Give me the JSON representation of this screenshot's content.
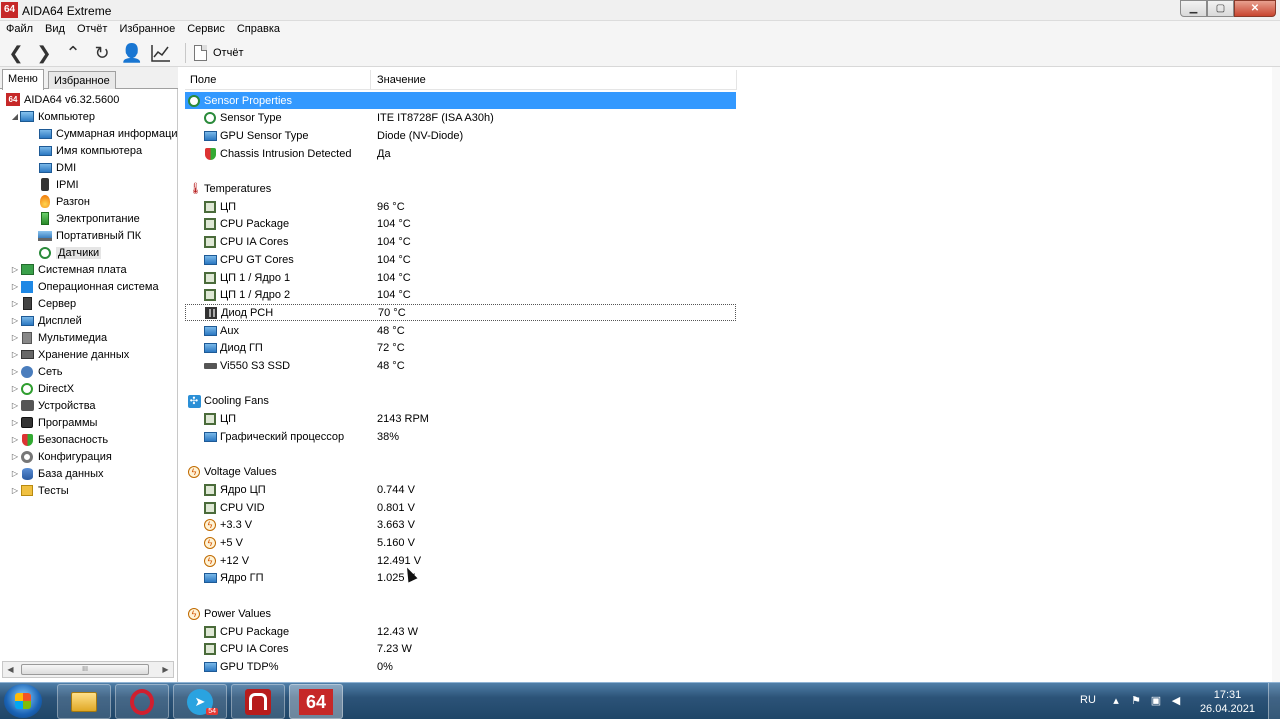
{
  "window": {
    "app_icon_text": "64",
    "title": "AIDA64 Extreme",
    "min_icon": "minimize-icon",
    "max_icon": "maximize-icon",
    "close_icon": "close-icon"
  },
  "menubar": [
    "Файл",
    "Вид",
    "Отчёт",
    "Избранное",
    "Сервис",
    "Справка"
  ],
  "toolbar": {
    "report_label": "Отчёт",
    "buttons": [
      "back-icon",
      "forward-icon",
      "up-icon",
      "refresh-icon",
      "user-icon",
      "chart-icon"
    ]
  },
  "left_tabs": {
    "menu": "Меню",
    "favorites": "Избранное"
  },
  "tree": [
    {
      "label": "AIDA64 v6.32.5600",
      "icon": "aida64-icon",
      "level": 0,
      "expander": ""
    },
    {
      "label": "Компьютер",
      "icon": "computer-icon",
      "level": 1,
      "expander": "◢"
    },
    {
      "label": "Суммарная информация",
      "icon": "monitor-icon",
      "level": 2,
      "expander": ""
    },
    {
      "label": "Имя компьютера",
      "icon": "monitor-icon",
      "level": 2,
      "expander": ""
    },
    {
      "label": "DMI",
      "icon": "monitor-icon",
      "level": 2,
      "expander": ""
    },
    {
      "label": "IPMI",
      "icon": "phone-icon",
      "level": 2,
      "expander": ""
    },
    {
      "label": "Разгон",
      "icon": "flame-icon",
      "level": 2,
      "expander": ""
    },
    {
      "label": "Электропитание",
      "icon": "power-icon",
      "level": 2,
      "expander": ""
    },
    {
      "label": "Портативный ПК",
      "icon": "laptop-icon",
      "level": 2,
      "expander": ""
    },
    {
      "label": "Датчики",
      "icon": "gauge-icon",
      "level": 2,
      "expander": "",
      "selected": true
    },
    {
      "label": "Системная плата",
      "icon": "motherboard-icon",
      "level": 1,
      "expander": "▷"
    },
    {
      "label": "Операционная система",
      "icon": "windows-icon",
      "level": 1,
      "expander": "▷"
    },
    {
      "label": "Сервер",
      "icon": "server-icon",
      "level": 1,
      "expander": "▷"
    },
    {
      "label": "Дисплей",
      "icon": "monitor-icon",
      "level": 1,
      "expander": "▷"
    },
    {
      "label": "Мультимедиа",
      "icon": "speaker-icon",
      "level": 1,
      "expander": "▷"
    },
    {
      "label": "Хранение данных",
      "icon": "hdd-icon",
      "level": 1,
      "expander": "▷"
    },
    {
      "label": "Сеть",
      "icon": "network-icon",
      "level": 1,
      "expander": "▷"
    },
    {
      "label": "DirectX",
      "icon": "xbox-icon",
      "level": 1,
      "expander": "▷"
    },
    {
      "label": "Устройства",
      "icon": "usb-icon",
      "level": 1,
      "expander": "▷"
    },
    {
      "label": "Программы",
      "icon": "camera-icon",
      "level": 1,
      "expander": "▷"
    },
    {
      "label": "Безопасность",
      "icon": "shield-icon",
      "level": 1,
      "expander": "▷"
    },
    {
      "label": "Конфигурация",
      "icon": "cog-icon",
      "level": 1,
      "expander": "▷"
    },
    {
      "label": "База данных",
      "icon": "database-icon",
      "level": 1,
      "expander": "▷"
    },
    {
      "label": "Тесты",
      "icon": "test-icon",
      "level": 1,
      "expander": "▷"
    }
  ],
  "columns": {
    "field": "Поле",
    "value": "Значение"
  },
  "rows": [
    {
      "type": "section",
      "field": "Sensor Properties",
      "value": "",
      "icon": "sensor-icon",
      "highlight": true
    },
    {
      "type": "item",
      "field": "Sensor Type",
      "value": "ITE IT8728F  (ISA A30h)",
      "icon": "gauge-icon"
    },
    {
      "type": "item",
      "field": "GPU Sensor Type",
      "value": "Diode  (NV-Diode)",
      "icon": "monitor-icon"
    },
    {
      "type": "item",
      "field": "Chassis Intrusion Detected",
      "value": "Да",
      "icon": "shield-icon"
    },
    {
      "type": "spacer"
    },
    {
      "type": "section",
      "field": "Temperatures",
      "value": "",
      "icon": "thermometer-icon"
    },
    {
      "type": "item",
      "field": "ЦП",
      "value": "96 °C",
      "icon": "cpu-chip-icon"
    },
    {
      "type": "item",
      "field": "CPU Package",
      "value": "104 °C",
      "icon": "cpu-chip-icon"
    },
    {
      "type": "item",
      "field": "CPU IA Cores",
      "value": "104 °C",
      "icon": "cpu-chip-icon"
    },
    {
      "type": "item",
      "field": "CPU GT Cores",
      "value": "104 °C",
      "icon": "monitor-icon"
    },
    {
      "type": "item",
      "field": "ЦП 1 / Ядро 1",
      "value": "104 °C",
      "icon": "cpu-chip-icon"
    },
    {
      "type": "item",
      "field": "ЦП 1 / Ядро 2",
      "value": "104 °C",
      "icon": "cpu-chip-icon"
    },
    {
      "type": "item",
      "field": "Диод PCH",
      "value": "70 °C",
      "icon": "pch-chip-icon",
      "focused": true
    },
    {
      "type": "item",
      "field": "Aux",
      "value": "48 °C",
      "icon": "monitor-icon"
    },
    {
      "type": "item",
      "field": "Диод ГП",
      "value": "72 °C",
      "icon": "monitor-icon"
    },
    {
      "type": "item",
      "field": "Vi550 S3 SSD",
      "value": "48 °C",
      "icon": "ssd-icon"
    },
    {
      "type": "spacer"
    },
    {
      "type": "section",
      "field": "Cooling Fans",
      "value": "",
      "icon": "fan-icon"
    },
    {
      "type": "item",
      "field": "ЦП",
      "value": "2143 RPM",
      "icon": "cpu-chip-icon"
    },
    {
      "type": "item",
      "field": "Графический процессор",
      "value": "38%",
      "icon": "monitor-icon"
    },
    {
      "type": "spacer"
    },
    {
      "type": "section",
      "field": "Voltage Values",
      "value": "",
      "icon": "bolt-icon"
    },
    {
      "type": "item",
      "field": "Ядро ЦП",
      "value": "0.744 V",
      "icon": "cpu-chip-icon"
    },
    {
      "type": "item",
      "field": "CPU VID",
      "value": "0.801 V",
      "icon": "cpu-chip-icon"
    },
    {
      "type": "item",
      "field": "+3.3 V",
      "value": "3.663 V",
      "icon": "bolt-icon"
    },
    {
      "type": "item",
      "field": "+5 V",
      "value": "5.160 V",
      "icon": "bolt-icon"
    },
    {
      "type": "item",
      "field": "+12 V",
      "value": "12.491 V",
      "icon": "bolt-icon"
    },
    {
      "type": "item",
      "field": "Ядро ГП",
      "value": "1.025 V",
      "icon": "monitor-icon"
    },
    {
      "type": "spacer"
    },
    {
      "type": "section",
      "field": "Power Values",
      "value": "",
      "icon": "bolt-icon"
    },
    {
      "type": "item",
      "field": "CPU Package",
      "value": "12.43 W",
      "icon": "cpu-chip-icon"
    },
    {
      "type": "item",
      "field": "CPU IA Cores",
      "value": "7.23 W",
      "icon": "cpu-chip-icon"
    },
    {
      "type": "item",
      "field": "GPU TDP%",
      "value": "0%",
      "icon": "monitor-icon"
    }
  ],
  "taskbar": {
    "apps": [
      "explorer-icon",
      "opera-icon",
      "telegram-icon",
      "red-app-icon",
      "aida64-icon"
    ],
    "telegram_badge": "54",
    "aida_text": "64",
    "lang": "RU",
    "time": "17:31",
    "date": "26.04.2021"
  },
  "colors": {
    "selection": "#3399ff",
    "brand": "#c62828"
  }
}
